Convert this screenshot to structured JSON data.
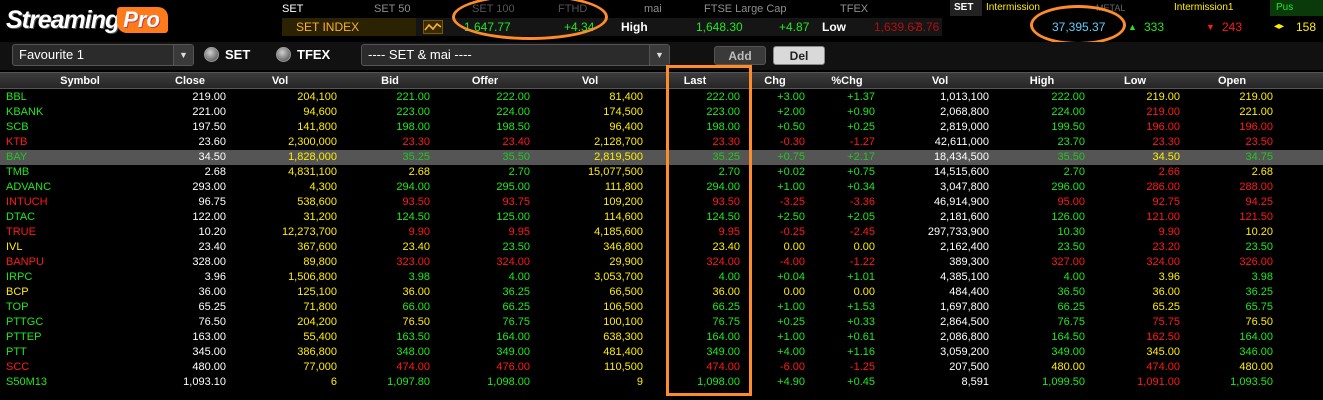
{
  "app": {
    "logo_text": "Streaming",
    "logo_badge": "Pro"
  },
  "market_tabs": [
    "SET",
    "SET 50",
    "SET 100",
    "mai",
    "FTSE Large Cap",
    "TFEX"
  ],
  "market_tabs_extra": "FTHD",
  "index_row": {
    "name": "SET INDEX",
    "value": "1,647.77",
    "change": "+4.34",
    "high_label": "High",
    "high_value": "1,648.30",
    "high_change": "+4.87",
    "low_label": "Low",
    "low_value": "1,639.67",
    "low_change": "-3.76"
  },
  "market_status": {
    "set_label": "SET",
    "set_status": "Intermission",
    "metal_label": "METAL",
    "metal_status": "Intermission1",
    "push_label": "Pus",
    "total_value": "37,395.37",
    "advance": "333",
    "decline": "243",
    "unchanged": "158",
    "up_icon": "triangle-up-icon",
    "down_icon": "triangle-down-icon",
    "unchanged_icon": "double-arrow-icon"
  },
  "toolbar": {
    "favourite": "Favourite 1",
    "radio_set": "SET",
    "radio_tfex": "TFEX",
    "market_filter": "---- SET & mai ----",
    "add": "Add",
    "del": "Del"
  },
  "columns": [
    "Symbol",
    "Close",
    "Vol",
    "Bid",
    "Offer",
    "Vol",
    "Last",
    "Chg",
    "%Chg",
    "Vol",
    "High",
    "Low",
    "Open"
  ],
  "colors": {
    "up": "#1fe81f",
    "down": "#ff1a1a",
    "unchanged": "#ffee00",
    "neutral": "#ffffff",
    "highlight": "#ff8c2b"
  },
  "rows": [
    {
      "symbol": "BBL",
      "close": "219.00",
      "vol": "204,100",
      "bid": "221.00",
      "offer": "222.00",
      "vol2": "81,400",
      "last": "222.00",
      "chg": "+3.00",
      "pchg": "+1.37",
      "vol3": "1,013,100",
      "high": "222.00",
      "low": "219.00",
      "open": "219.00",
      "c": {
        "sym": "g",
        "vol": "y",
        "bid": "g",
        "offer": "g",
        "vol2": "y",
        "last": "g",
        "chg": "g",
        "pchg": "g",
        "high": "g",
        "low": "y",
        "open": "y"
      }
    },
    {
      "symbol": "KBANK",
      "close": "221.00",
      "vol": "94,600",
      "bid": "223.00",
      "offer": "224.00",
      "vol2": "174,500",
      "last": "223.00",
      "chg": "+2.00",
      "pchg": "+0.90",
      "vol3": "2,068,800",
      "high": "224.00",
      "low": "219.00",
      "open": "221.00",
      "c": {
        "sym": "g",
        "vol": "y",
        "bid": "g",
        "offer": "g",
        "vol2": "y",
        "last": "g",
        "chg": "g",
        "pchg": "g",
        "high": "g",
        "low": "r",
        "open": "y"
      }
    },
    {
      "symbol": "SCB",
      "close": "197.50",
      "vol": "141,800",
      "bid": "198.00",
      "offer": "198.50",
      "vol2": "96,400",
      "last": "198.00",
      "chg": "+0.50",
      "pchg": "+0.25",
      "vol3": "2,819,000",
      "high": "199.50",
      "low": "196.00",
      "open": "196.00",
      "c": {
        "sym": "g",
        "vol": "y",
        "bid": "g",
        "offer": "g",
        "vol2": "y",
        "last": "g",
        "chg": "g",
        "pchg": "g",
        "high": "g",
        "low": "r",
        "open": "r"
      }
    },
    {
      "symbol": "KTB",
      "close": "23.60",
      "vol": "2,300,000",
      "bid": "23.30",
      "offer": "23.40",
      "vol2": "2,128,700",
      "last": "23.30",
      "chg": "-0.30",
      "pchg": "-1.27",
      "vol3": "42,611,000",
      "high": "23.70",
      "low": "23.30",
      "open": "23.50",
      "c": {
        "sym": "r",
        "vol": "y",
        "bid": "r",
        "offer": "r",
        "vol2": "y",
        "last": "r",
        "chg": "r",
        "pchg": "r",
        "high": "g",
        "low": "r",
        "open": "r"
      }
    },
    {
      "symbol": "BAY",
      "close": "34.50",
      "vol": "1,828,000",
      "bid": "35.25",
      "offer": "35.50",
      "vol2": "2,819,500",
      "last": "35.25",
      "chg": "+0.75",
      "pchg": "+2.17",
      "vol3": "18,434,500",
      "high": "35.50",
      "low": "34.50",
      "open": "34.75",
      "selected": true,
      "c": {
        "sym": "g",
        "vol": "y",
        "bid": "g",
        "offer": "g",
        "vol2": "y",
        "last": "g",
        "chg": "g",
        "pchg": "g",
        "high": "g",
        "low": "y",
        "open": "g"
      }
    },
    {
      "symbol": "TMB",
      "close": "2.68",
      "vol": "4,831,100",
      "bid": "2.68",
      "offer": "2.70",
      "vol2": "15,077,500",
      "last": "2.70",
      "chg": "+0.02",
      "pchg": "+0.75",
      "vol3": "14,515,600",
      "high": "2.70",
      "low": "2.66",
      "open": "2.68",
      "c": {
        "sym": "g",
        "vol": "y",
        "bid": "y",
        "offer": "g",
        "vol2": "y",
        "last": "g",
        "chg": "g",
        "pchg": "g",
        "high": "g",
        "low": "r",
        "open": "y"
      }
    },
    {
      "symbol": "ADVANC",
      "close": "293.00",
      "vol": "4,300",
      "bid": "294.00",
      "offer": "295.00",
      "vol2": "111,800",
      "last": "294.00",
      "chg": "+1.00",
      "pchg": "+0.34",
      "vol3": "3,047,800",
      "high": "296.00",
      "low": "286.00",
      "open": "288.00",
      "c": {
        "sym": "g",
        "vol": "y",
        "bid": "g",
        "offer": "g",
        "vol2": "y",
        "last": "g",
        "chg": "g",
        "pchg": "g",
        "high": "g",
        "low": "r",
        "open": "r"
      }
    },
    {
      "symbol": "INTUCH",
      "close": "96.75",
      "vol": "538,600",
      "bid": "93.50",
      "offer": "93.75",
      "vol2": "109,200",
      "last": "93.50",
      "chg": "-3.25",
      "pchg": "-3.36",
      "vol3": "46,914,900",
      "high": "95.00",
      "low": "92.75",
      "open": "94.25",
      "c": {
        "sym": "r",
        "vol": "y",
        "bid": "r",
        "offer": "r",
        "vol2": "y",
        "last": "r",
        "chg": "r",
        "pchg": "r",
        "high": "r",
        "low": "r",
        "open": "r"
      }
    },
    {
      "symbol": "DTAC",
      "close": "122.00",
      "vol": "31,200",
      "bid": "124.50",
      "offer": "125.00",
      "vol2": "114,600",
      "last": "124.50",
      "chg": "+2.50",
      "pchg": "+2.05",
      "vol3": "2,181,600",
      "high": "126.00",
      "low": "121.00",
      "open": "121.50",
      "c": {
        "sym": "g",
        "vol": "y",
        "bid": "g",
        "offer": "g",
        "vol2": "y",
        "last": "g",
        "chg": "g",
        "pchg": "g",
        "high": "g",
        "low": "r",
        "open": "r"
      }
    },
    {
      "symbol": "TRUE",
      "close": "10.20",
      "vol": "12,273,700",
      "bid": "9.90",
      "offer": "9.95",
      "vol2": "4,185,600",
      "last": "9.95",
      "chg": "-0.25",
      "pchg": "-2.45",
      "vol3": "297,733,900",
      "high": "10.30",
      "low": "9.90",
      "open": "10.20",
      "c": {
        "sym": "r",
        "vol": "y",
        "bid": "r",
        "offer": "r",
        "vol2": "y",
        "last": "r",
        "chg": "r",
        "pchg": "r",
        "high": "g",
        "low": "r",
        "open": "y"
      }
    },
    {
      "symbol": "IVL",
      "close": "23.40",
      "vol": "367,600",
      "bid": "23.40",
      "offer": "23.50",
      "vol2": "346,800",
      "last": "23.40",
      "chg": "0.00",
      "pchg": "0.00",
      "vol3": "2,162,400",
      "high": "23.50",
      "low": "23.20",
      "open": "23.50",
      "c": {
        "sym": "y",
        "vol": "y",
        "bid": "y",
        "offer": "g",
        "vol2": "y",
        "last": "y",
        "chg": "y",
        "pchg": "y",
        "high": "g",
        "low": "r",
        "open": "g"
      }
    },
    {
      "symbol": "BANPU",
      "close": "328.00",
      "vol": "89,800",
      "bid": "323.00",
      "offer": "324.00",
      "vol2": "29,900",
      "last": "324.00",
      "chg": "-4.00",
      "pchg": "-1.22",
      "vol3": "389,300",
      "high": "327.00",
      "low": "324.00",
      "open": "326.00",
      "c": {
        "sym": "r",
        "vol": "y",
        "bid": "r",
        "offer": "r",
        "vol2": "y",
        "last": "r",
        "chg": "r",
        "pchg": "r",
        "high": "r",
        "low": "r",
        "open": "r"
      }
    },
    {
      "symbol": "IRPC",
      "close": "3.96",
      "vol": "1,506,800",
      "bid": "3.98",
      "offer": "4.00",
      "vol2": "3,053,700",
      "last": "4.00",
      "chg": "+0.04",
      "pchg": "+1.01",
      "vol3": "4,385,100",
      "high": "4.00",
      "low": "3.96",
      "open": "3.98",
      "c": {
        "sym": "g",
        "vol": "y",
        "bid": "g",
        "offer": "g",
        "vol2": "y",
        "last": "g",
        "chg": "g",
        "pchg": "g",
        "high": "g",
        "low": "y",
        "open": "g"
      }
    },
    {
      "symbol": "BCP",
      "close": "36.00",
      "vol": "125,100",
      "bid": "36.00",
      "offer": "36.25",
      "vol2": "66,500",
      "last": "36.00",
      "chg": "0.00",
      "pchg": "0.00",
      "vol3": "484,400",
      "high": "36.50",
      "low": "36.00",
      "open": "36.25",
      "c": {
        "sym": "y",
        "vol": "y",
        "bid": "y",
        "offer": "g",
        "vol2": "y",
        "last": "y",
        "chg": "y",
        "pchg": "y",
        "high": "g",
        "low": "y",
        "open": "g"
      }
    },
    {
      "symbol": "TOP",
      "close": "65.25",
      "vol": "71,800",
      "bid": "66.00",
      "offer": "66.25",
      "vol2": "106,500",
      "last": "66.25",
      "chg": "+1.00",
      "pchg": "+1.53",
      "vol3": "1,697,800",
      "high": "66.25",
      "low": "65.25",
      "open": "65.75",
      "c": {
        "sym": "g",
        "vol": "y",
        "bid": "g",
        "offer": "g",
        "vol2": "y",
        "last": "g",
        "chg": "g",
        "pchg": "g",
        "high": "g",
        "low": "y",
        "open": "g"
      }
    },
    {
      "symbol": "PTTGC",
      "close": "76.50",
      "vol": "204,200",
      "bid": "76.50",
      "offer": "76.75",
      "vol2": "100,100",
      "last": "76.75",
      "chg": "+0.25",
      "pchg": "+0.33",
      "vol3": "2,864,500",
      "high": "76.75",
      "low": "75.75",
      "open": "76.50",
      "c": {
        "sym": "g",
        "vol": "y",
        "bid": "y",
        "offer": "g",
        "vol2": "y",
        "last": "g",
        "chg": "g",
        "pchg": "g",
        "high": "g",
        "low": "r",
        "open": "y"
      }
    },
    {
      "symbol": "PTTEP",
      "close": "163.00",
      "vol": "55,400",
      "bid": "163.50",
      "offer": "164.00",
      "vol2": "638,300",
      "last": "164.00",
      "chg": "+1.00",
      "pchg": "+0.61",
      "vol3": "2,086,800",
      "high": "164.50",
      "low": "162.50",
      "open": "164.00",
      "c": {
        "sym": "g",
        "vol": "y",
        "bid": "g",
        "offer": "g",
        "vol2": "y",
        "last": "g",
        "chg": "g",
        "pchg": "g",
        "high": "g",
        "low": "r",
        "open": "g"
      }
    },
    {
      "symbol": "PTT",
      "close": "345.00",
      "vol": "386,800",
      "bid": "348.00",
      "offer": "349.00",
      "vol2": "481,400",
      "last": "349.00",
      "chg": "+4.00",
      "pchg": "+1.16",
      "vol3": "3,059,200",
      "high": "349.00",
      "low": "345.00",
      "open": "346.00",
      "c": {
        "sym": "g",
        "vol": "y",
        "bid": "g",
        "offer": "g",
        "vol2": "y",
        "last": "g",
        "chg": "g",
        "pchg": "g",
        "high": "g",
        "low": "y",
        "open": "g"
      }
    },
    {
      "symbol": "SCC",
      "close": "480.00",
      "vol": "77,000",
      "bid": "474.00",
      "offer": "476.00",
      "vol2": "110,500",
      "last": "474.00",
      "chg": "-6.00",
      "pchg": "-1.25",
      "vol3": "207,500",
      "high": "480.00",
      "low": "474.00",
      "open": "480.00",
      "c": {
        "sym": "r",
        "vol": "y",
        "bid": "r",
        "offer": "r",
        "vol2": "y",
        "last": "r",
        "chg": "r",
        "pchg": "r",
        "high": "y",
        "low": "r",
        "open": "y"
      }
    },
    {
      "symbol": "S50M13",
      "close": "1,093.10",
      "vol": "6",
      "bid": "1,097.80",
      "offer": "1,098.00",
      "vol2": "9",
      "last": "1,098.00",
      "chg": "+4.90",
      "pchg": "+0.45",
      "vol3": "8,591",
      "high": "1,099.50",
      "low": "1,091.00",
      "open": "1,093.50",
      "c": {
        "sym": "g",
        "vol": "y",
        "bid": "g",
        "offer": "g",
        "vol2": "y",
        "last": "g",
        "chg": "g",
        "pchg": "g",
        "high": "g",
        "low": "r",
        "open": "g"
      }
    }
  ]
}
